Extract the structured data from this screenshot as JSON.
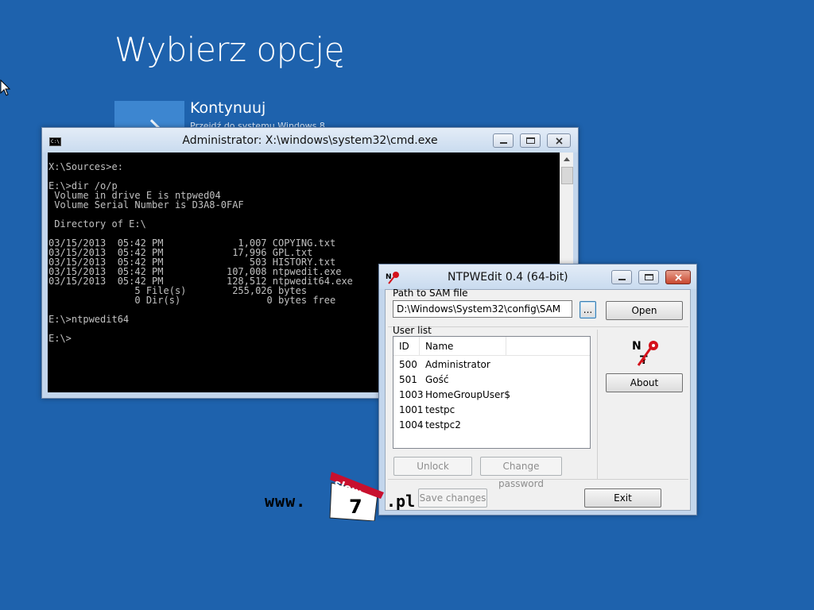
{
  "recovery": {
    "title": "Wybierz opcję",
    "continue_title": "Kontynuuj",
    "continue_subtitle": "Przejdź do systemu Windows 8"
  },
  "cmd": {
    "title": "Administrator: X:\\windows\\system32\\cmd.exe",
    "icon_text": "C:\\",
    "lines": [
      "X:\\Sources>e:",
      "",
      "E:\\>dir /o/p",
      " Volume in drive E is ntpwed04",
      " Volume Serial Number is D3A8-0FAF",
      "",
      " Directory of E:\\",
      "",
      "03/15/2013  05:42 PM             1,007 COPYING.txt",
      "03/15/2013  05:42 PM            17,996 GPL.txt",
      "03/15/2013  05:42 PM               503 HISTORY.txt",
      "03/15/2013  05:42 PM           107,008 ntpwedit.exe",
      "03/15/2013  05:42 PM           128,512 ntpwedit64.exe",
      "               5 File(s)        255,026 bytes",
      "               0 Dir(s)               0 bytes free",
      "",
      "E:\\>ntpwedit64",
      "",
      "E:\\>"
    ]
  },
  "ntpwedit": {
    "title": "NTPWEdit 0.4 (64-bit)",
    "path_label": "Path to SAM file",
    "path_value": "D:\\Windows\\System32\\config\\SAM",
    "browse_label": "...",
    "open_label": "Open",
    "user_list_label": "User list",
    "columns": {
      "id": "ID",
      "name": "Name"
    },
    "users": [
      {
        "id": "500",
        "name": "Administrator"
      },
      {
        "id": "501",
        "name": "Gość"
      },
      {
        "id": "1003",
        "name": "HomeGroupUser$"
      },
      {
        "id": "1001",
        "name": "testpc"
      },
      {
        "id": "1004",
        "name": "testpc2"
      }
    ],
    "logo_text": "NT",
    "about_label": "About",
    "unlock_label": "Unlock",
    "change_password_label": "Change password",
    "save_changes_label": "Save changes",
    "exit_label": "Exit"
  },
  "watermark": {
    "prefix": "www.",
    "top": "slow",
    "number": "7",
    "suffix": ".pl"
  },
  "colors": {
    "desktop": "#1e62ad",
    "tile": "#3d86d0",
    "console_bg": "#000000",
    "console_fg": "#c0c0c0",
    "close_button": "#c8472f",
    "logo_red": "#d4121b"
  },
  "icons": [
    "mouse-cursor-icon",
    "cmd-icon",
    "minimize-icon",
    "maximize-icon",
    "close-icon",
    "ntpwedit-icon",
    "arrow-right-icon",
    "scroll-up-icon"
  ]
}
